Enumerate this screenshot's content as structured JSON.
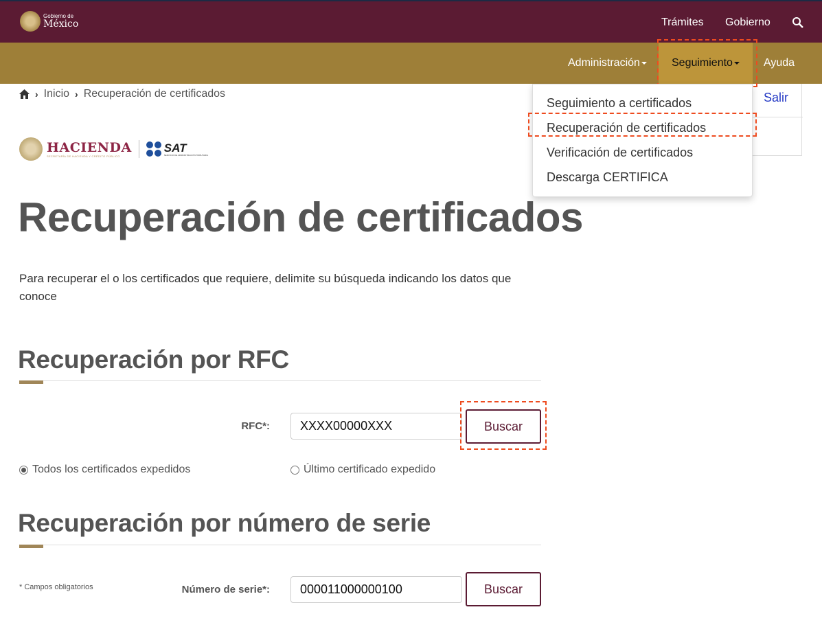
{
  "header": {
    "logo_small": "Gobierno de",
    "logo_big": "México",
    "links": [
      "Trámites",
      "Gobierno"
    ]
  },
  "subnav": {
    "items": [
      "Administración",
      "Seguimiento",
      "Ayuda"
    ]
  },
  "dropdown": {
    "items": [
      "Seguimiento a certificados",
      "Recuperación de certificados",
      "Verificación de certificados",
      "Descarga CERTIFICA"
    ]
  },
  "side": {
    "salir": "Salir"
  },
  "breadcrumb": [
    "Inicio",
    "Recuperación de certificados"
  ],
  "brand": {
    "hacienda": "HACIENDA",
    "hacienda_sub": "SECRETARÍA DE HACIENDA Y CRÉDITO PÚBLICO",
    "sat": "SAT",
    "sat_sub": "SERVICIO DE ADMINISTRACIÓN TRIBUTARIA"
  },
  "page": {
    "title": "Recuperación de certificados",
    "intro": "Para recuperar el o los certificados que requiere, delimite su búsqueda indicando los datos que conoce"
  },
  "rfc": {
    "heading": "Recuperación por RFC",
    "label": "RFC*:",
    "value": "XXXX00000XXX",
    "button": "Buscar",
    "options": [
      "Todos los certificados expedidos",
      "Último certificado expedido"
    ]
  },
  "serie": {
    "heading": "Recuperación por número de serie",
    "label": "Número de serie*:",
    "value": "000011000000100",
    "button": "Buscar",
    "required_note": "* Campos obligatorios"
  }
}
